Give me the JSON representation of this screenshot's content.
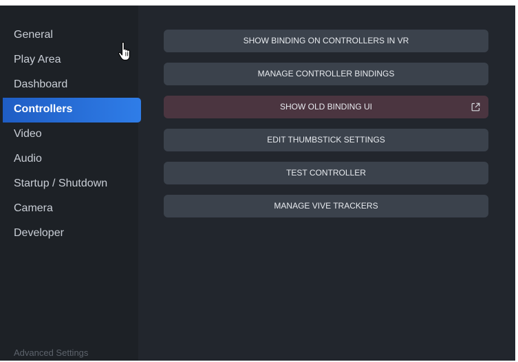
{
  "sidebar": {
    "items": [
      {
        "label": "General",
        "active": false
      },
      {
        "label": "Play Area",
        "active": false
      },
      {
        "label": "Dashboard",
        "active": false
      },
      {
        "label": "Controllers",
        "active": true
      },
      {
        "label": "Video",
        "active": false
      },
      {
        "label": "Audio",
        "active": false
      },
      {
        "label": "Startup / Shutdown",
        "active": false
      },
      {
        "label": "Camera",
        "active": false
      },
      {
        "label": "Developer",
        "active": false
      }
    ],
    "advanced_label": "Advanced Settings"
  },
  "main": {
    "buttons": [
      {
        "label": "SHOW BINDING ON CONTROLLERS IN VR"
      },
      {
        "label": "MANAGE CONTROLLER BINDINGS"
      },
      {
        "label": "SHOW OLD BINDING UI",
        "icon": "external-link-icon"
      },
      {
        "label": "EDIT THUMBSTICK SETTINGS"
      },
      {
        "label": "TEST CONTROLLER"
      },
      {
        "label": "MANAGE VIVE TRACKERS"
      }
    ]
  },
  "colors": {
    "window_bg": "#22262d",
    "sidebar_bg": "#1d2126",
    "accent": "#2f7de8",
    "button_bg": "#3b424c",
    "legacy_button_bg": "#4b3540"
  },
  "cursor": "hand-pointer-icon"
}
